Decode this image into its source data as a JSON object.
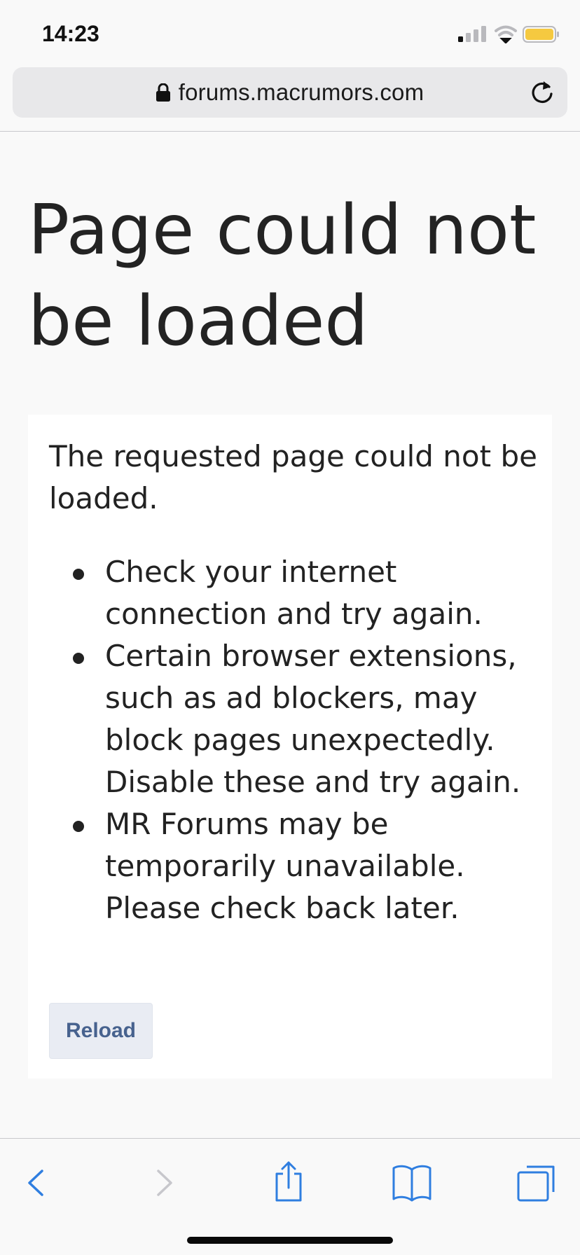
{
  "status_bar": {
    "time": "14:23",
    "icons": [
      "cellular-signal-icon",
      "wifi-icon",
      "battery-icon"
    ],
    "battery_color": "#f5c940"
  },
  "address_bar": {
    "url": "forums.macrumors.com",
    "icons": [
      "lock-icon",
      "reload-icon"
    ]
  },
  "page": {
    "heading": "Page could not be loaded",
    "intro": "The requested page could not be loaded.",
    "hints": [
      "Check your internet connection and try again.",
      "Certain browser extensions, such as ad blockers, may block pages unexpectedly. Disable these and try again.",
      "MR Forums may be temporarily unavailable. Please check back later."
    ],
    "reload_label": "Reload"
  },
  "toolbar": {
    "buttons": [
      "back-icon",
      "forward-icon",
      "share-icon",
      "bookmarks-icon",
      "tabs-icon"
    ],
    "accent_color": "#2f7ee0",
    "disabled_color": "#c7c7cc"
  }
}
